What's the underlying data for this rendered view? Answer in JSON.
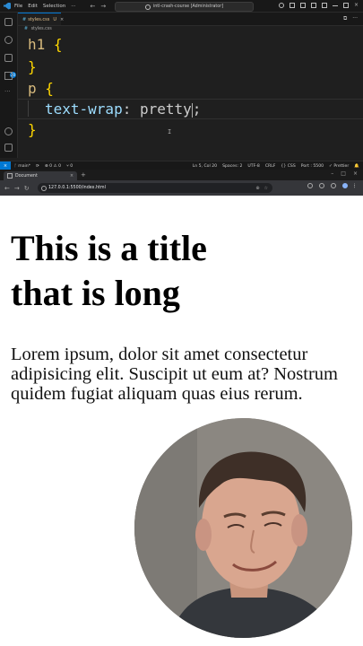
{
  "vscode": {
    "menu": [
      "File",
      "Edit",
      "Selection",
      "···"
    ],
    "search_text": "intl-crash-course [Administrator]",
    "tab": {
      "icon": "#",
      "label": "styles.css",
      "status": "U",
      "close": "×"
    },
    "breadcrumb": {
      "icon": "#",
      "label": "styles.css"
    },
    "code": {
      "line1_selector": "h1",
      "line1_brace": "{",
      "line2_brace": "}",
      "line3_selector": "p",
      "line3_brace": "{",
      "line4_property": "text-wrap",
      "line4_colon": ":",
      "line4_value": "pretty",
      "line4_semicolon": ";",
      "line5_brace": "}"
    },
    "status": {
      "remote": "⨯",
      "branch": "ᚴ main*",
      "sync": "⟳",
      "problems": "⊗ 0 ⚠ 0",
      "ports": "⑂ 0",
      "position": "Ln 5, Col 20",
      "spaces": "Spaces: 2",
      "encoding": "UTF-8",
      "eol": "CRLF",
      "language": "{} CSS",
      "port": "Port : 5500",
      "prettier": "✓ Prettier",
      "bell": "🔔"
    },
    "activity_badge": "20"
  },
  "browser": {
    "tab_title": "Document",
    "tab_close": "×",
    "new_tab": "+",
    "url": "127.0.0.1:5500/index.html"
  },
  "page": {
    "title": "This is a title that is long",
    "paragraph": "Lorem ipsum, dolor sit amet consectetur adipisicing elit. Suscipit ut eum at? Nostrum quidem fugiat aliquam quas eius rerum."
  }
}
